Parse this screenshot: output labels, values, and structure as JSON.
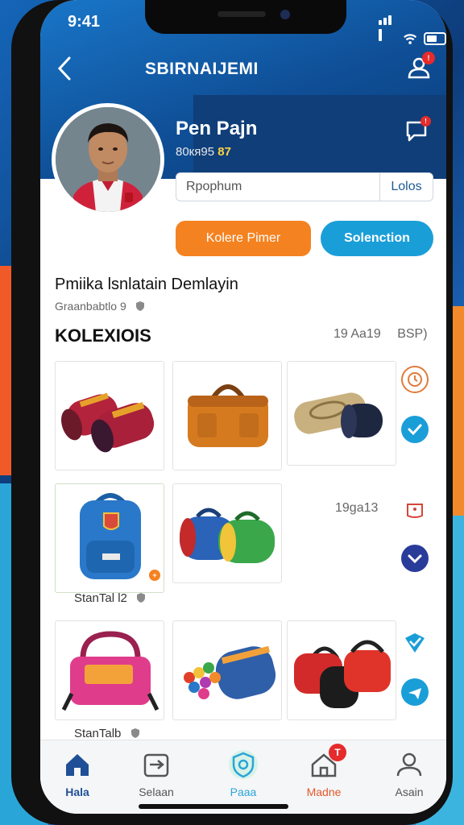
{
  "status": {
    "time": "9:41"
  },
  "header": {
    "title": "SBIRNAIJEMI"
  },
  "profile": {
    "name": "Pen Pajn",
    "sub_prefix": "80кя95",
    "sub_highlight": "87"
  },
  "search": {
    "placeholder": "Rpophum",
    "button": "Lolos"
  },
  "actions": {
    "primary": "Kolere Pimer",
    "secondary": "Solenction"
  },
  "section": {
    "title": "Pmiika lsnlatain Demlayin",
    "subtitle": "Graanbabtlo 9"
  },
  "collections": {
    "heading": "KOLEXIOIS",
    "meta_count": "19 Aa19",
    "meta_tag": "BSP)",
    "row2_count": "19ga13",
    "captions": [
      "StanTal l2",
      "StanTalb"
    ]
  },
  "nav": [
    {
      "label": "Hala",
      "icon": "home-icon",
      "color": "#1f4f96"
    },
    {
      "label": "Selaan",
      "icon": "card-icon",
      "color": "#555555"
    },
    {
      "label": "Paaa",
      "icon": "shield-icon",
      "color": "#2aa5d8"
    },
    {
      "label": "Madne",
      "icon": "store-icon",
      "color": "#e25a2b"
    },
    {
      "label": "Asain",
      "icon": "person-icon",
      "color": "#555555"
    }
  ],
  "nav_badge": "T",
  "colors": {
    "accent_orange": "#f58220",
    "accent_blue": "#1a9ed8",
    "header_blue": "#0f4f97",
    "badge_red": "#e52b2b"
  }
}
